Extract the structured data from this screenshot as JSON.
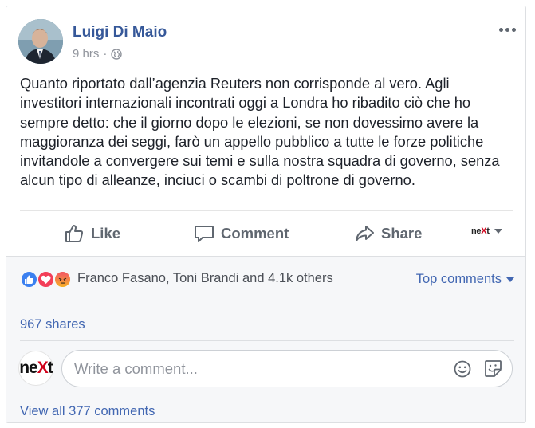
{
  "post": {
    "author": "Luigi Di Maio",
    "time": "9 hrs",
    "separator": "·",
    "privacy_icon": "globe-icon",
    "text": "Quanto riportato dall’agenzia Reuters non corrisponde al vero. Agli investitori internazionali incontrati oggi a Londra ho ribadito ciò che ho sempre detto: che il giorno dopo le elezioni, se non dovessimo avere la maggioranza dei seggi, farò un appello pubblico a tutte le forze politiche invitandole a convergere sui temi e sulla nostra squadra di governo, senza alcun tipo di alleanze, inciuci o scambi di poltrone di governo."
  },
  "actions": {
    "like": "Like",
    "comment": "Comment",
    "share": "Share",
    "page_logo": "neXt"
  },
  "engagement": {
    "reactions": [
      "like-icon",
      "love-icon",
      "angry-icon"
    ],
    "reactors_text": "Franco Fasano, Toni Brandi and 4.1k others",
    "sort_label": "Top comments",
    "shares_text": "967 shares"
  },
  "comment_box": {
    "avatar_text": "neXt",
    "placeholder": "Write a comment...",
    "view_all": "View all 377 comments"
  },
  "colors": {
    "name_blue": "#365899",
    "link_blue": "#4267b2",
    "gray_text": "#90949c",
    "accent_red": "#d0021b"
  }
}
